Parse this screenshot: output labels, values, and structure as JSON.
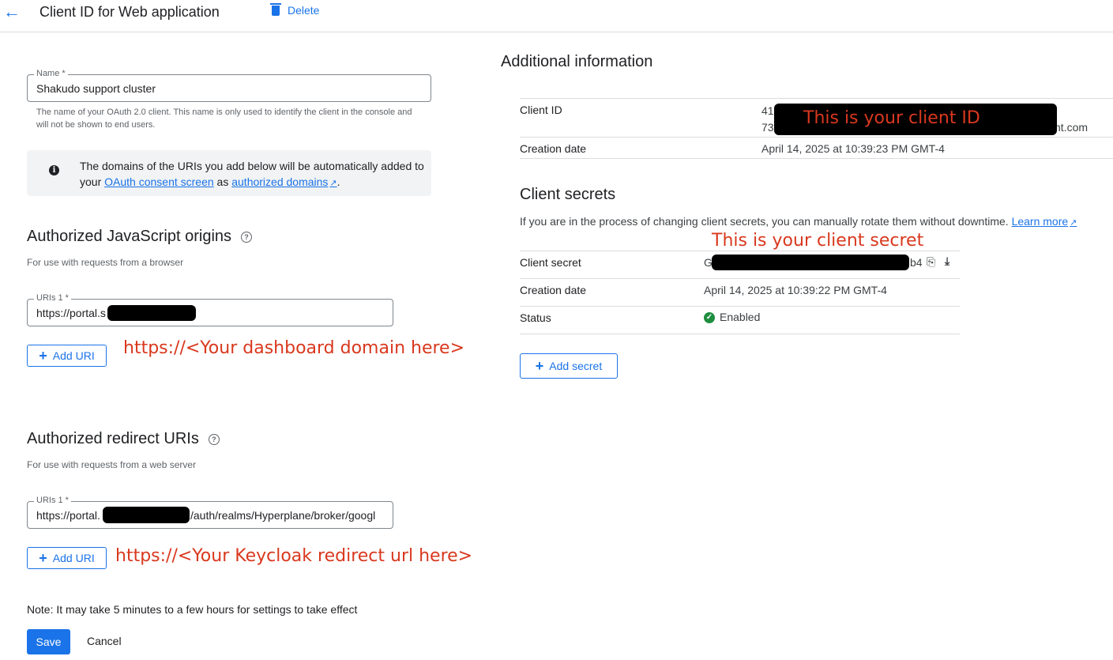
{
  "header": {
    "title": "Client ID for Web application",
    "delete_label": "Delete"
  },
  "name_field": {
    "label": "Name *",
    "value": "Shakudo support cluster",
    "hint": "The name of your OAuth 2.0 client. This name is only used to identify the client in the console and will not be shown to end users."
  },
  "info_banner": {
    "text_before": "The domains of the URIs you add below will be automatically added to your",
    "link1": "OAuth consent screen",
    "middle": "as",
    "link2": "authorized domains",
    "text_after": "."
  },
  "js_origins": {
    "heading": "Authorized JavaScript origins",
    "subtitle": "For use with requests from a browser",
    "field_label": "URIs 1 *",
    "field_value": "https://portal.s",
    "add_label": "Add URI",
    "annotation": "https://<Your dashboard domain here>"
  },
  "redirect_uris": {
    "heading": "Authorized redirect URIs",
    "subtitle": "For use with requests from a web server",
    "field_label": "URIs 1 *",
    "field_value_start": "https://portal.",
    "field_value_end": "/auth/realms/Hyperplane/broker/googl",
    "add_label": "Add URI",
    "annotation": "https://<Your Keycloak redirect url here>"
  },
  "note": "Note: It may take 5 minutes to a few hours for settings to take effect",
  "save_label": "Save",
  "cancel_label": "Cancel",
  "additional_info": {
    "heading": "Additional information",
    "client_id_label": "Client ID",
    "client_id_line1": "41",
    "client_id_line2_start": "73",
    "client_id_line2_end": "nt.com",
    "client_id_annotation": "This is your client ID",
    "creation_label": "Creation date",
    "creation_value": "April 14, 2025 at 10:39:23 PM GMT-4"
  },
  "client_secrets": {
    "heading": "Client secrets",
    "description": "If you are in the process of changing client secrets, you can manually rotate them without downtime.",
    "learn_more": "Learn more",
    "annotation": "This is your client secret",
    "secret_label": "Client secret",
    "secret_start": "G",
    "secret_end": "b4",
    "creation_label": "Creation date",
    "creation_value": "April 14, 2025 at 10:39:22 PM GMT-4",
    "status_label": "Status",
    "status_value": "Enabled",
    "add_secret_label": "Add secret"
  },
  "colors": {
    "accent": "#1a73e8",
    "annotation": "#d9381e",
    "enabled": "#1e8e3e"
  }
}
